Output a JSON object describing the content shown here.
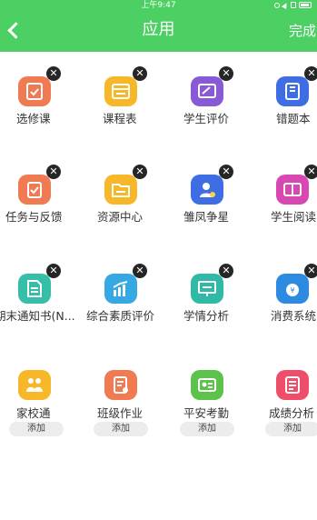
{
  "status_bar": {
    "time": "上午9:47"
  },
  "header": {
    "title": "应用",
    "done_label": "完成"
  },
  "apps": [
    {
      "label": "选修课",
      "icon": "checklist-icon",
      "color": "#f07b52"
    },
    {
      "label": "课程表",
      "icon": "schedule-icon",
      "color": "#f6b829"
    },
    {
      "label": "学生评价",
      "icon": "edit-note-icon",
      "color": "#8a5ad6"
    },
    {
      "label": "错题本",
      "icon": "notebook-icon",
      "color": "#3f6de3"
    },
    {
      "label": "任务与反馈",
      "icon": "clipboard-check-icon",
      "color": "#f07b52"
    },
    {
      "label": "资源中心",
      "icon": "folder-icon",
      "color": "#f6b829"
    },
    {
      "label": "雏凤争星",
      "icon": "user-star-icon",
      "color": "#3f6de3"
    },
    {
      "label": "学生阅读",
      "icon": "book-icon",
      "color": "#d748b0"
    },
    {
      "label": "期末通知书(N...",
      "icon": "document-icon",
      "color": "#35bfa8"
    },
    {
      "label": "综合素质评价",
      "icon": "bar-chart-icon",
      "color": "#36a8e3"
    },
    {
      "label": "学情分析",
      "icon": "presentation-icon",
      "color": "#2fb9a6"
    },
    {
      "label": "消费系统",
      "icon": "money-bag-icon",
      "color": "#2c8ae0"
    }
  ],
  "more_apps": [
    {
      "label": "家校通",
      "icon": "family-icon",
      "color": "#f6b829",
      "add_label": "添加"
    },
    {
      "label": "班级作业",
      "icon": "homework-icon",
      "color": "#f07b52",
      "add_label": "添加"
    },
    {
      "label": "平安考勤",
      "icon": "id-card-icon",
      "color": "#5cc24b",
      "add_label": "添加"
    },
    {
      "label": "成绩分析",
      "icon": "report-icon",
      "color": "#ef4e6b",
      "add_label": "添加"
    }
  ]
}
